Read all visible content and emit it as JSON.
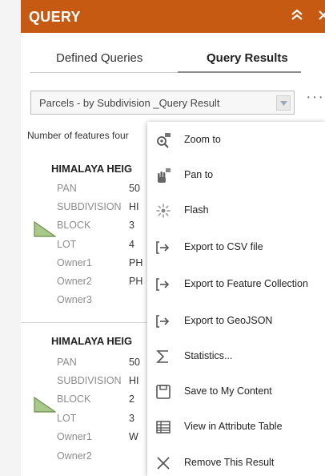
{
  "header": {
    "title": "QUERY"
  },
  "tabs": [
    {
      "label": "Defined Queries",
      "active": false
    },
    {
      "label": "Query Results",
      "active": true
    }
  ],
  "layer_select": {
    "value": "Parcels - by Subdivision _Query Result"
  },
  "features_count_text": "Number of features four",
  "results": [
    {
      "title": "HIMALAYA HEIG",
      "attributes": [
        {
          "key": "PAN",
          "value": "50"
        },
        {
          "key": "SUBDIVISION",
          "value": "HI"
        },
        {
          "key": "BLOCK",
          "value": "3"
        },
        {
          "key": "LOT",
          "value": "4"
        },
        {
          "key": "Owner1",
          "value": "PH"
        },
        {
          "key": "Owner2",
          "value": "PH"
        },
        {
          "key": "Owner3",
          "value": ""
        }
      ]
    },
    {
      "title": "HIMALAYA HEIG",
      "attributes": [
        {
          "key": "PAN",
          "value": "50"
        },
        {
          "key": "SUBDIVISION",
          "value": "HI"
        },
        {
          "key": "BLOCK",
          "value": "2"
        },
        {
          "key": "LOT",
          "value": "3"
        },
        {
          "key": "Owner1",
          "value": "W"
        },
        {
          "key": "Owner2",
          "value": ""
        }
      ]
    }
  ],
  "menu": [
    {
      "label": "Zoom to",
      "icon": "zoom-to-icon"
    },
    {
      "label": "Pan to",
      "icon": "pan-hand-icon"
    },
    {
      "label": "Flash",
      "icon": "flash-icon"
    },
    {
      "label": "Export to CSV file",
      "icon": "export-icon"
    },
    {
      "label": "Export to Feature Collection",
      "icon": "export-icon"
    },
    {
      "label": "Export to GeoJSON",
      "icon": "export-icon"
    },
    {
      "label": "Statistics...",
      "icon": "sigma-icon"
    },
    {
      "label": "Save to My Content",
      "icon": "save-icon"
    },
    {
      "label": "View in Attribute Table",
      "icon": "table-icon"
    },
    {
      "label": "Remove This Result",
      "icon": "close-icon"
    }
  ],
  "colors": {
    "header_bg": "#c75a12",
    "symbol_fill": "#a8c98a",
    "symbol_stroke": "#6b8f4a"
  }
}
